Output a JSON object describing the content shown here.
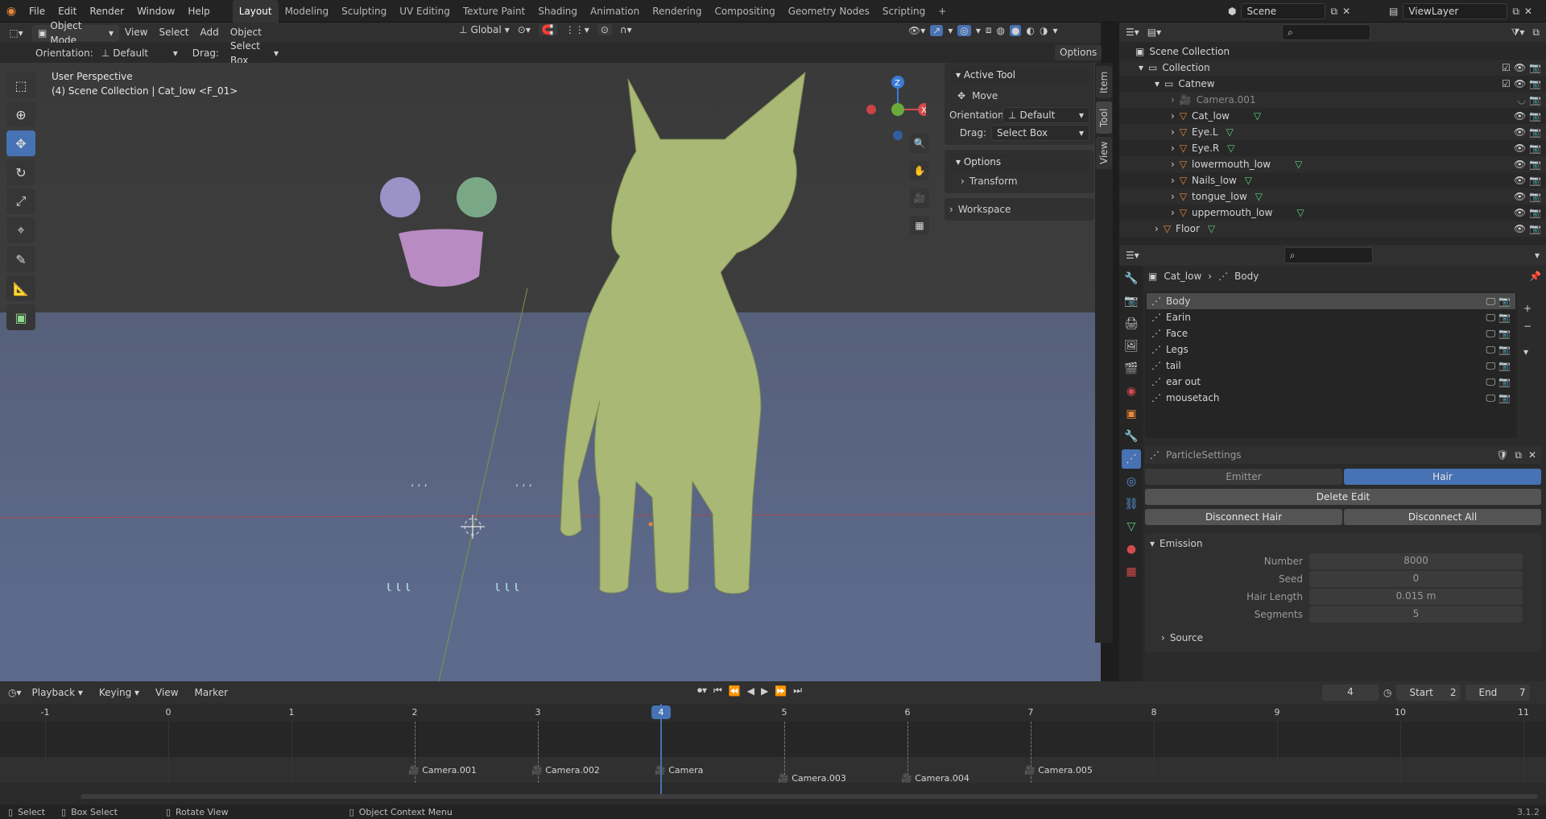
{
  "topbar": {
    "menus": [
      "File",
      "Edit",
      "Render",
      "Window",
      "Help"
    ],
    "workspaces": [
      "Layout",
      "Modeling",
      "Sculpting",
      "UV Editing",
      "Texture Paint",
      "Shading",
      "Animation",
      "Rendering",
      "Compositing",
      "Geometry Nodes",
      "Scripting"
    ],
    "add_workspace": "+",
    "scene": "Scene",
    "view_layer": "ViewLayer"
  },
  "viewport_header": {
    "mode": "Object Mode",
    "menus": [
      "View",
      "Select",
      "Add",
      "Object"
    ],
    "transform_orientation": "Global"
  },
  "tool_settings": {
    "orientation_label": "Orientation:",
    "orientation_value": "Default",
    "drag_label": "Drag:",
    "drag_value": "Select Box",
    "options": "Options"
  },
  "viewport": {
    "line1": "User Perspective",
    "line2": "(4) Scene Collection | Cat_low <F_01>",
    "gizmo": {
      "z": "Z",
      "x": "X"
    }
  },
  "npanel": {
    "active_tool": "Active Tool",
    "move": "Move",
    "orientation_label": "Orientation",
    "orientation_value": "Default",
    "drag_label": "Drag:",
    "drag_value": "Select Box",
    "options": "Options",
    "transform": "Transform",
    "workspace": "Workspace",
    "tabs": [
      "Item",
      "Tool",
      "View"
    ]
  },
  "outliner": {
    "root": "Scene Collection",
    "items": [
      {
        "label": "Collection",
        "depth": 0
      },
      {
        "label": "Catnew",
        "depth": 1
      },
      {
        "label": "Camera.001",
        "depth": 2
      },
      {
        "label": "Cat_low",
        "depth": 2
      },
      {
        "label": "Eye.L",
        "depth": 2
      },
      {
        "label": "Eye.R",
        "depth": 2
      },
      {
        "label": "lowermouth_low",
        "depth": 2
      },
      {
        "label": "Nails_low",
        "depth": 2
      },
      {
        "label": "tongue_low",
        "depth": 2
      },
      {
        "label": "uppermouth_low",
        "depth": 2
      },
      {
        "label": "Floor",
        "depth": 1
      }
    ]
  },
  "properties": {
    "breadcrumb_object": "Cat_low",
    "breadcrumb_group": "Body",
    "vertex_groups": [
      "Body",
      "Earin",
      "Face",
      "Legs",
      "tail",
      "ear out",
      "mousetach"
    ],
    "particle_settings": "ParticleSettings",
    "emitter": "Emitter",
    "hair": "Hair",
    "delete_edit": "Delete Edit",
    "disconnect_hair": "Disconnect Hair",
    "disconnect_all": "Disconnect All",
    "emission": "Emission",
    "fields": [
      {
        "label": "Number",
        "value": "8000"
      },
      {
        "label": "Seed",
        "value": "0"
      },
      {
        "label": "Hair Length",
        "value": "0.015 m"
      },
      {
        "label": "Segments",
        "value": "5"
      }
    ],
    "source": "Source"
  },
  "timeline": {
    "menus": [
      "Playback",
      "Keying",
      "View",
      "Marker"
    ],
    "current_frame": "4",
    "start_label": "Start",
    "start": "2",
    "end_label": "End",
    "end": "7",
    "ticks": [
      "-1",
      "0",
      "1",
      "2",
      "3",
      "4",
      "5",
      "6",
      "7",
      "8",
      "9",
      "10",
      "11"
    ],
    "markers": [
      {
        "label": "Camera.001",
        "frame": 2
      },
      {
        "label": "Camera.002",
        "frame": 3
      },
      {
        "label": "Camera",
        "frame": 4
      },
      {
        "label": "Camera.003",
        "frame": 5
      },
      {
        "label": "Camera.004",
        "frame": 6
      },
      {
        "label": "Camera.005",
        "frame": 7
      }
    ]
  },
  "statusbar": {
    "select": "Select",
    "box_select": "Box Select",
    "rotate": "Rotate View",
    "context": "Object Context Menu",
    "version": "3.1.2"
  },
  "colors": {
    "accent": "#4772b3",
    "object_orange": "#e8873a",
    "mesh_green": "#5fd07a",
    "cat": "#a9b875"
  }
}
